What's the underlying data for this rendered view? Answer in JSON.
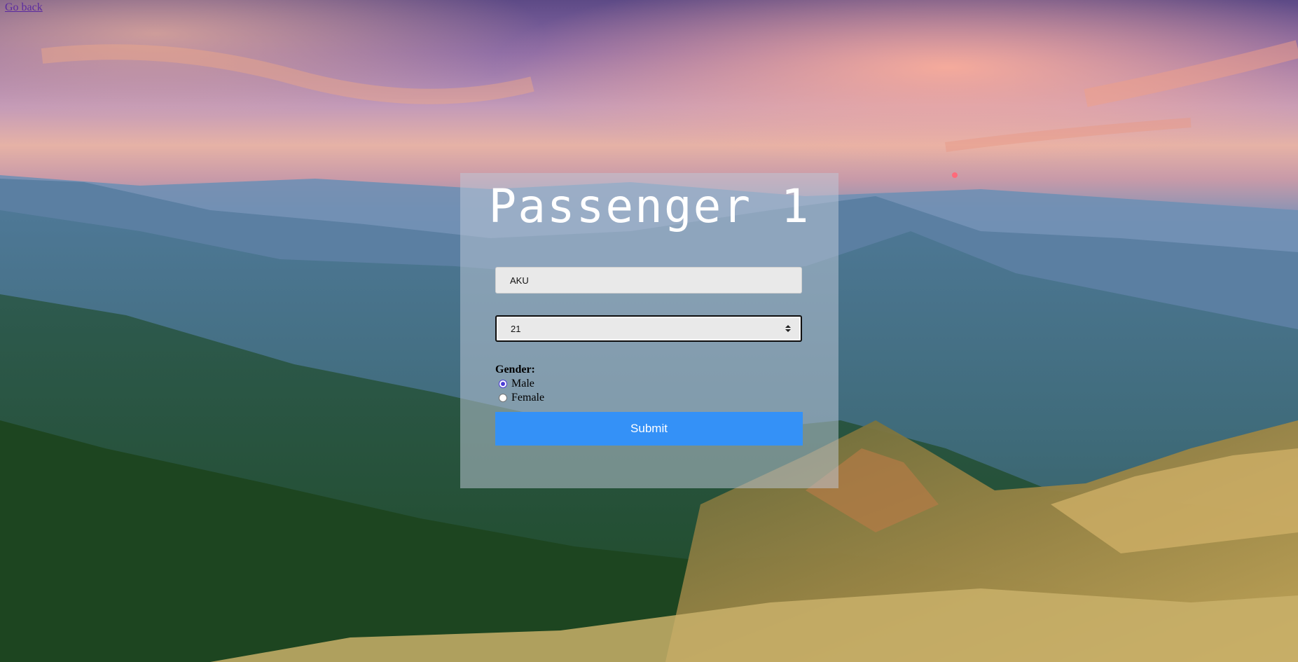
{
  "top_link": {
    "label": "Go back"
  },
  "form": {
    "title": "Passenger 1",
    "name_value": "AKU",
    "age_value": "21",
    "gender_label": "Gender:",
    "gender_options": [
      {
        "label": "Male",
        "checked": true
      },
      {
        "label": "Female",
        "checked": false
      }
    ],
    "submit_label": "Submit"
  },
  "colors": {
    "submit_bg": "#3491f7",
    "radio_accent": "#4b3bd6"
  },
  "icons": {
    "spinner": "number-spinner-icon"
  }
}
